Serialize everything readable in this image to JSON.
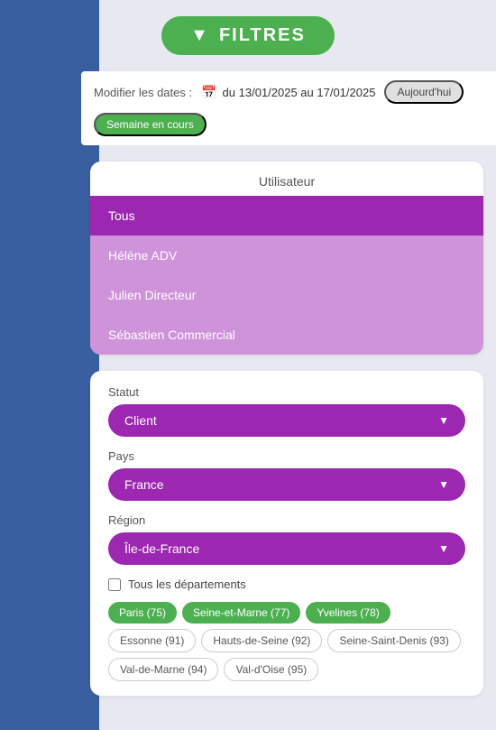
{
  "header": {
    "filter_button_label": "FILTRES",
    "funnel_icon": "⬛"
  },
  "date_bar": {
    "label": "Modifier les dates :",
    "range": "du 13/01/2025 au 17/01/2025",
    "today_label": "Aujourd'hui",
    "week_label": "Semaine en cours"
  },
  "utilisateur": {
    "title": "Utilisateur",
    "items": [
      {
        "label": "Tous",
        "style": "active"
      },
      {
        "label": "Hélène ADV",
        "style": "light"
      },
      {
        "label": "Julien Directeur",
        "style": "light"
      },
      {
        "label": "Sébastien Commercial",
        "style": "light"
      }
    ]
  },
  "filters": {
    "statut": {
      "label": "Statut",
      "selected": "Client"
    },
    "pays": {
      "label": "Pays",
      "selected": "France"
    },
    "region": {
      "label": "Région",
      "selected": "Île-de-France"
    },
    "checkbox": {
      "label": "Tous les départements",
      "checked": false
    },
    "departments": [
      {
        "label": "Paris (75)",
        "style": "green"
      },
      {
        "label": "Seine-et-Marne (77)",
        "style": "green"
      },
      {
        "label": "Yvelines (78)",
        "style": "green"
      },
      {
        "label": "Essonne (91)",
        "style": "outline"
      },
      {
        "label": "Hauts-de-Seine (92)",
        "style": "outline"
      },
      {
        "label": "Seine-Saint-Denis (93)",
        "style": "outline"
      },
      {
        "label": "Val-de-Marne (94)",
        "style": "outline"
      },
      {
        "label": "Val-d'Oise (95)",
        "style": "outline"
      }
    ]
  }
}
